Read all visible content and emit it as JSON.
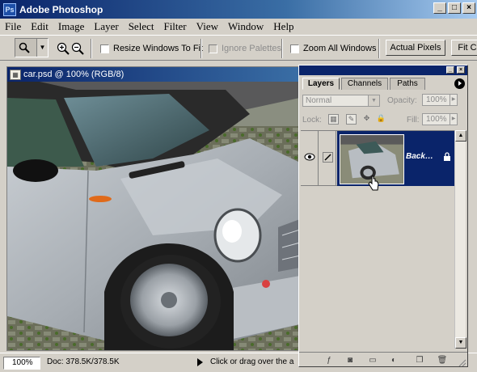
{
  "window": {
    "title": "Adobe Photoshop",
    "app_icon_label": "Ps"
  },
  "menu": [
    {
      "label": "File"
    },
    {
      "label": "Edit"
    },
    {
      "label": "Image"
    },
    {
      "label": "Layer"
    },
    {
      "label": "Select"
    },
    {
      "label": "Filter"
    },
    {
      "label": "View"
    },
    {
      "label": "Window"
    },
    {
      "label": "Help"
    }
  ],
  "options": {
    "resize_windows": "Resize Windows To Fit",
    "ignore_palettes": "Ignore Palettes",
    "zoom_all": "Zoom All Windows",
    "actual_pixels": "Actual Pixels",
    "fit_screen": "Fit C"
  },
  "document": {
    "title": "car.psd @ 100% (RGB/8)"
  },
  "status": {
    "zoom": "100%",
    "doc_info": "Doc: 378.5K/378.5K",
    "hint": "Click or drag over the a"
  },
  "layers_palette": {
    "tabs": [
      {
        "label": "Layers"
      },
      {
        "label": "Channels"
      },
      {
        "label": "Paths"
      }
    ],
    "blend_mode": "Normal",
    "opacity_label": "Opacity:",
    "opacity_value": "100%",
    "lock_label": "Lock:",
    "fill_label": "Fill:",
    "fill_value": "100%",
    "layers": [
      {
        "name": "Back…",
        "selected": true,
        "visible": true,
        "locked": true
      }
    ]
  },
  "colors": {
    "title_bar": "#0a246a",
    "selected_layer": "#0a246a",
    "chrome": "#d4d0c8"
  }
}
